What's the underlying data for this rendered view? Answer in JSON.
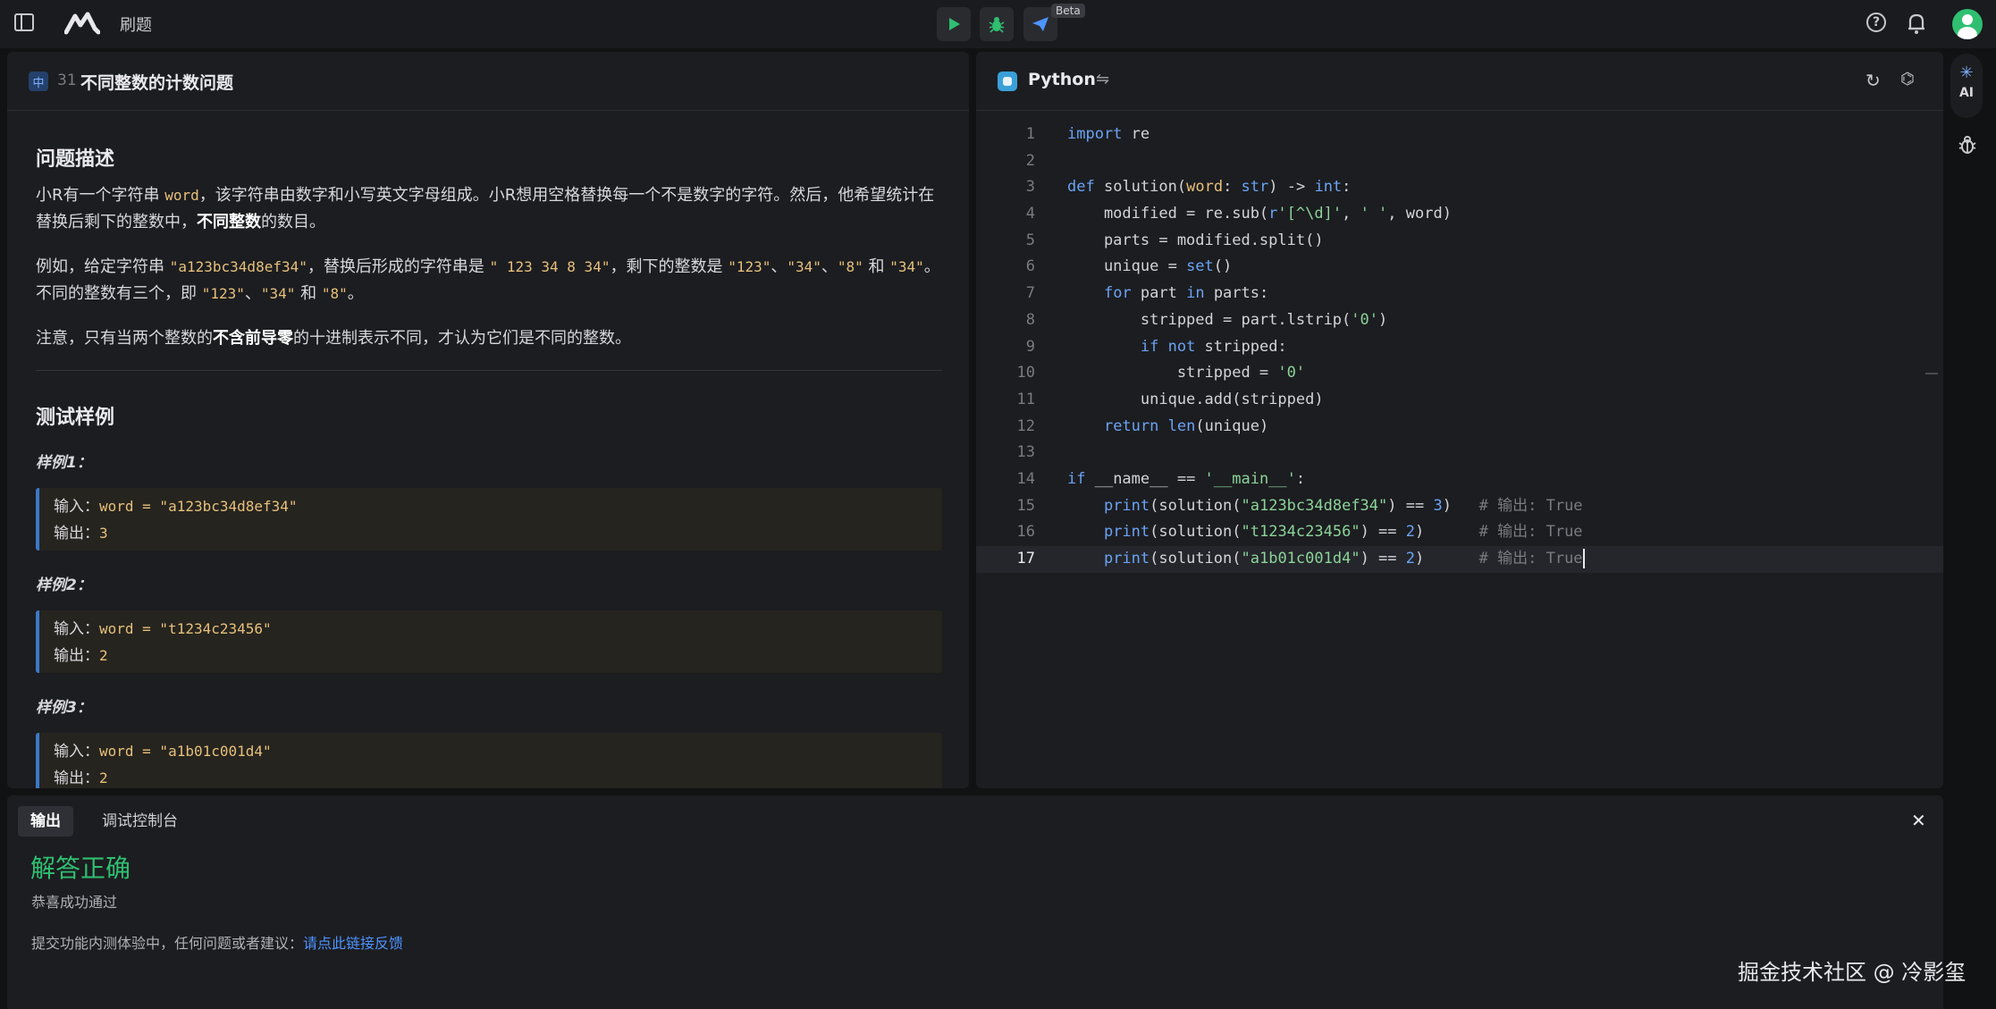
{
  "topbar": {
    "title": "刷题",
    "beta_label": "Beta"
  },
  "problem": {
    "difficulty": "中",
    "number": "31",
    "title": "不同整数的计数问题",
    "description_heading": "问题描述",
    "para1": {
      "t1": "小R有一个字符串 ",
      "code1": "word",
      "t2": "，该字符串由数字和小写英文字母组成。小R想用空格替换每一个不是数字的字符。然后，他希望统计在替换后剩下的整数中，",
      "bold": "不同整数",
      "t3": "的数目。"
    },
    "para2": {
      "t1": "例如，给定字符串 ",
      "code1": "\"a123bc34d8ef34\"",
      "t2": "，替换后形成的字符串是 ",
      "code2": "\" 123 34 8 34\"",
      "t3": "，剩下的整数是 ",
      "code3": "\"123\"",
      "sep1": "、",
      "code4": "\"34\"",
      "sep2": "、",
      "code5": "\"8\"",
      "t4": " 和 ",
      "code6": "\"34\"",
      "t5": "。不同的整数有三个，即 ",
      "code7": "\"123\"",
      "sep3": "、",
      "code8": "\"34\"",
      "t6": " 和 ",
      "code9": "\"8\"",
      "t7": "。"
    },
    "para3": {
      "t1": "注意，只有当两个整数的",
      "bold": "不含前导零",
      "t2": "的十进制表示不同，才认为它们是不同的整数。"
    },
    "samples_heading": "测试样例",
    "samples": [
      {
        "label": "样例1：",
        "input_label": "输入：",
        "input": "word = \"a123bc34d8ef34\"",
        "output_label": "输出：",
        "output": "3"
      },
      {
        "label": "样例2：",
        "input_label": "输入：",
        "input": "word = \"t1234c23456\"",
        "output_label": "输出：",
        "output": "2"
      },
      {
        "label": "样例3：",
        "input_label": "输入：",
        "input": "word = \"a1b01c001d4\"",
        "output_label": "输出：",
        "output": "2"
      }
    ]
  },
  "editor": {
    "language": "Python",
    "line_numbers": [
      "1",
      "2",
      "3",
      "4",
      "5",
      "6",
      "7",
      "8",
      "9",
      "10",
      "11",
      "12",
      "13",
      "14",
      "15",
      "16",
      "17"
    ],
    "active_line": 17
  },
  "right_rail": {
    "ai_label": "AI"
  },
  "output": {
    "tabs": [
      "输出",
      "调试控制台"
    ],
    "result": "解答正确",
    "subtext": "恭喜成功通过",
    "feedback_text": "提交功能内测体验中，任何问题或者建议：",
    "feedback_link": "请点此链接反馈"
  },
  "watermark": "掘金技术社区 @ 冷影玺",
  "colors": {
    "accent_green": "#2fbf71",
    "accent_blue": "#4d94ff",
    "keyword": "#6aa3f5",
    "string": "#8bd39a"
  }
}
